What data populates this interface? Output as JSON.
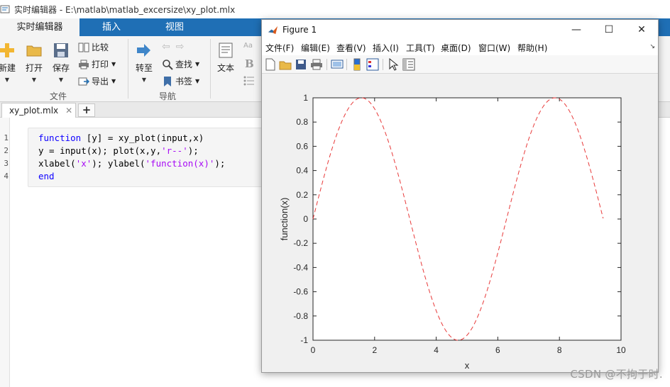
{
  "window": {
    "title": "实时编辑器 - E:\\matlab\\matlab_excersize\\xy_plot.mlx"
  },
  "ribbon_tabs": [
    {
      "label": "实时编辑器",
      "active": true
    },
    {
      "label": "插入",
      "active": false
    },
    {
      "label": "视图",
      "active": false
    }
  ],
  "ribbon": {
    "file_group": {
      "new": "新建",
      "open": "打开",
      "save": "保存",
      "compare": "比较",
      "print": "打印",
      "export": "导出",
      "label": "文件"
    },
    "nav_group": {
      "goto": "转至",
      "find": "查找",
      "bookmark": "书签",
      "label": "导航"
    },
    "text_group": {
      "text": "文本",
      "bold": "B"
    }
  },
  "doc_tab": {
    "name": "xy_plot.mlx",
    "close": "✕",
    "add": "+"
  },
  "code": {
    "line_numbers": [
      "1",
      "2",
      "3",
      "4"
    ],
    "lines": [
      [
        {
          "t": "function",
          "c": "kw"
        },
        {
          "t": " [y] = xy_plot(input,x)",
          "c": ""
        }
      ],
      [
        {
          "t": "y = input(x); plot(x,y,",
          "c": ""
        },
        {
          "t": "'r--'",
          "c": "str"
        },
        {
          "t": ");",
          "c": ""
        }
      ],
      [
        {
          "t": "xlabel(",
          "c": ""
        },
        {
          "t": "'x'",
          "c": "str"
        },
        {
          "t": "); ylabel(",
          "c": ""
        },
        {
          "t": "'function(x)'",
          "c": "str"
        },
        {
          "t": ");",
          "c": ""
        }
      ],
      [
        {
          "t": "end",
          "c": "kw"
        }
      ]
    ]
  },
  "figure": {
    "title": "Figure 1",
    "controls": {
      "minimize": "—",
      "maximize": "☐",
      "close": "✕"
    },
    "menus": [
      "文件(F)",
      "编辑(E)",
      "查看(V)",
      "插入(I)",
      "工具(T)",
      "桌面(D)",
      "窗口(W)",
      "帮助(H)"
    ],
    "menu_arrow": "↘"
  },
  "chart_data": {
    "type": "line",
    "series": [
      {
        "function": "sin",
        "x_range": [
          0,
          9.42
        ],
        "style": "dashed",
        "color": "#e83a3a"
      }
    ],
    "xlabel": "x",
    "ylabel": "function(x)",
    "xlim": [
      0,
      10
    ],
    "ylim": [
      -1,
      1
    ],
    "xticks": [
      0,
      2,
      4,
      6,
      8,
      10
    ],
    "yticks": [
      -1,
      -0.8,
      -0.6,
      -0.4,
      -0.2,
      0,
      0.2,
      0.4,
      0.6,
      0.8,
      1
    ],
    "grid": false
  },
  "watermark": "CSDN @不拘于时."
}
